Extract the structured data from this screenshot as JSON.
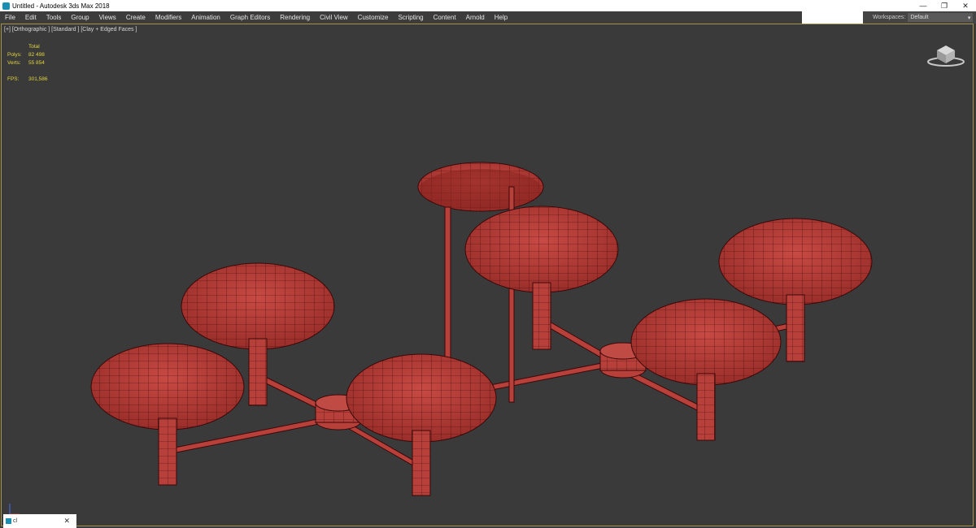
{
  "window": {
    "title": "Untitled - Autodesk 3ds Max 2018"
  },
  "window_controls": {
    "minimize": "—",
    "restore": "❐",
    "close": "✕"
  },
  "menu": [
    {
      "label": "File"
    },
    {
      "label": "Edit"
    },
    {
      "label": "Tools"
    },
    {
      "label": "Group"
    },
    {
      "label": "Views"
    },
    {
      "label": "Create"
    },
    {
      "label": "Modifiers"
    },
    {
      "label": "Animation"
    },
    {
      "label": "Graph Editors"
    },
    {
      "label": "Rendering"
    },
    {
      "label": "Civil View"
    },
    {
      "label": "Customize"
    },
    {
      "label": "Scripting"
    },
    {
      "label": "Content"
    },
    {
      "label": "Arnold"
    },
    {
      "label": "Help"
    }
  ],
  "workspaces": {
    "label": "Workspaces:",
    "value": "Default"
  },
  "viewport": {
    "label": "[+] [Orthographic ] [Standard ] [Clay + Edged Faces ]",
    "stats": {
      "total_label": "Total",
      "polys_label": "Polys:",
      "polys_value": "82 498",
      "verts_label": "Verts:",
      "verts_value": "55 854",
      "fps_label": "FPS:",
      "fps_value": "301,586"
    }
  },
  "colors": {
    "model": "#b8403a",
    "wire": "#3a0808",
    "viewport_bg": "#3a3a3a",
    "viewport_border": "#a89448"
  },
  "statusbar": {
    "tab_label": "cl",
    "close": "✕"
  }
}
